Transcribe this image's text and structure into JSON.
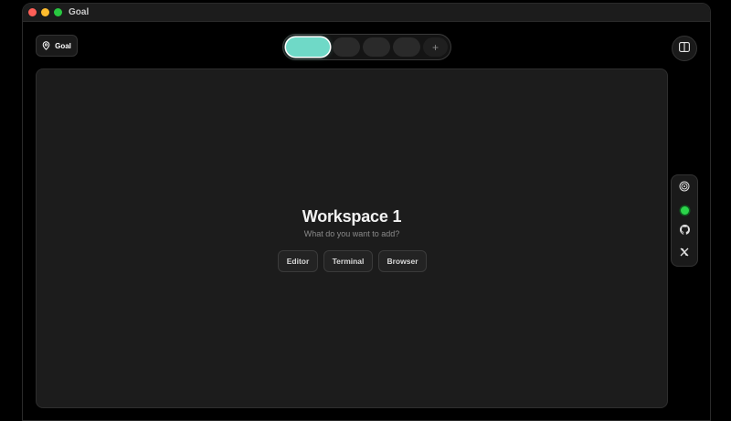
{
  "window": {
    "title": "Goal"
  },
  "header": {
    "goal_button_label": "Goal",
    "goal_icon": "location-pin-icon",
    "tabs": [
      {
        "id": "tab-1",
        "active": true
      },
      {
        "id": "tab-2",
        "active": false
      },
      {
        "id": "tab-3",
        "active": false
      },
      {
        "id": "tab-4",
        "active": false
      }
    ],
    "add_tab_label": "+",
    "panel_toggle_icon": "split-panel-icon"
  },
  "workspace": {
    "title": "Workspace 1",
    "subtitle": "What do you want to add?",
    "buttons": [
      {
        "id": "editor",
        "label": "Editor"
      },
      {
        "id": "terminal",
        "label": "Terminal"
      },
      {
        "id": "browser",
        "label": "Browser"
      }
    ]
  },
  "side_rail": {
    "items": [
      {
        "id": "target",
        "icon": "target-icon"
      },
      {
        "id": "status",
        "icon": "status-dot",
        "color": "#2bd44a"
      },
      {
        "id": "github",
        "icon": "github-icon"
      },
      {
        "id": "x",
        "icon": "x-logo-icon"
      }
    ]
  },
  "colors": {
    "accent": "#6fd9c7",
    "background": "#000000",
    "panel": "#1c1c1c"
  }
}
